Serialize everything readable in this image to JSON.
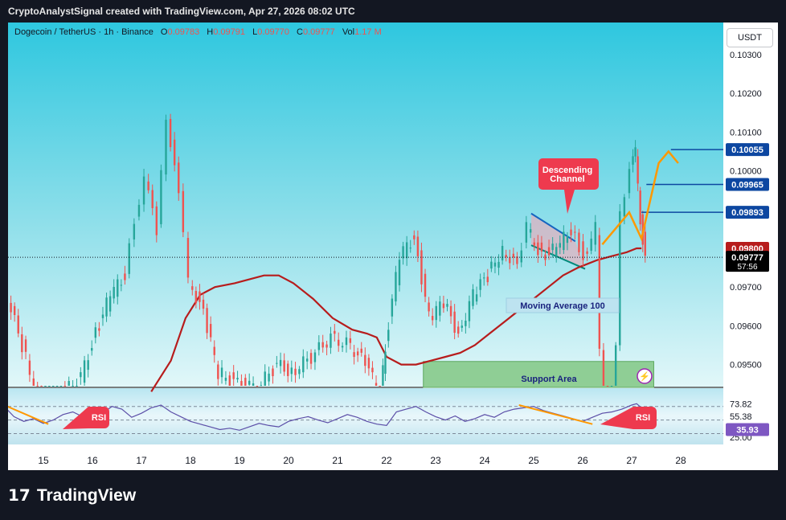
{
  "header": {
    "credit": "CryptoAnalystSignal created with TradingView.com, Apr 27, 2026 08:02 UTC",
    "symbol": "Dogecoin / TetherUS · 1h · Binance",
    "ohlc": {
      "O": "0.09783",
      "H": "0.09791",
      "L": "0.09770",
      "C": "0.09777",
      "Vol": "1.17 M"
    },
    "o_label": "O",
    "h_label": "H",
    "l_label": "L",
    "c_label": "C",
    "vol_label": "Vol",
    "currency_button": "USDT"
  },
  "footer": {
    "brand": "TradingView"
  },
  "colors": {
    "up": "#26a69a",
    "down": "#ef5350",
    "ma": "#b71c1c",
    "level": "#0d47a1",
    "arrow": "#ff9800",
    "support": "#81c784"
  },
  "chart_data": [
    {
      "type": "line",
      "title": "Dogecoin / TetherUS · 1h · Binance",
      "ylim": [
        0.0945,
        0.1035
      ],
      "x_ticks": [
        "15",
        "16",
        "17",
        "18",
        "19",
        "20",
        "21",
        "22",
        "23",
        "24",
        "25",
        "26",
        "27",
        "28"
      ],
      "y_ticks": [
        "0.10300",
        "0.10200",
        "0.10100",
        "0.10000",
        "0.09700",
        "0.09600",
        "0.09500"
      ],
      "price_labels": [
        {
          "value": 0.10055,
          "text": "0.10055"
        },
        {
          "value": 0.09965,
          "text": "0.09965"
        },
        {
          "value": 0.09893,
          "text": "0.09893"
        },
        {
          "value": 0.098,
          "text": "0.09800"
        },
        {
          "value": 0.09777,
          "text": "0.09777",
          "countdown": "57:56"
        }
      ],
      "price_path": {
        "days": [
          14.0,
          14.3,
          14.6,
          15.0,
          15.4,
          15.8,
          16.1,
          16.4,
          16.7,
          16.9,
          17.1,
          17.35,
          17.55,
          17.8,
          18.0,
          18.3,
          18.6,
          19.0,
          19.4,
          19.8,
          20.1,
          20.5,
          20.9,
          21.3,
          21.6,
          21.9,
          22.0,
          22.3,
          22.6,
          22.9,
          23.2,
          23.5,
          23.8,
          24.1,
          24.4,
          24.7,
          24.9,
          25.2,
          25.5,
          25.8,
          26.05,
          26.3,
          26.55,
          26.8,
          27.0,
          27.1,
          27.2,
          27.3
        ],
        "prices": [
          0.0952,
          0.0967,
          0.0955,
          0.0938,
          0.0942,
          0.0947,
          0.0958,
          0.0968,
          0.0973,
          0.0988,
          0.0998,
          0.0985,
          0.1015,
          0.0993,
          0.0972,
          0.0963,
          0.0948,
          0.0945,
          0.0944,
          0.095,
          0.0948,
          0.0952,
          0.0957,
          0.0955,
          0.095,
          0.0943,
          0.0955,
          0.0978,
          0.0983,
          0.0962,
          0.0966,
          0.0958,
          0.0968,
          0.0973,
          0.098,
          0.0975,
          0.0985,
          0.0978,
          0.098,
          0.0985,
          0.0978,
          0.0985,
          0.089,
          0.099,
          0.1,
          0.1005,
          0.0988,
          0.0977
        ]
      },
      "moving_average": {
        "label": "Moving Average 100",
        "days": [
          17.2,
          17.6,
          17.9,
          18.2,
          18.5,
          18.9,
          19.2,
          19.5,
          19.8,
          20.1,
          20.5,
          20.9,
          21.3,
          21.6,
          21.8,
          22.0,
          22.3,
          22.6,
          22.9,
          23.2,
          23.5,
          23.8,
          24.1,
          24.4,
          24.7,
          25.0,
          25.3,
          25.6,
          25.9,
          26.1,
          26.3,
          26.6,
          26.9,
          27.1,
          27.2
        ],
        "values": [
          0.0943,
          0.0951,
          0.0962,
          0.0968,
          0.097,
          0.0971,
          0.0972,
          0.0973,
          0.0973,
          0.0971,
          0.0967,
          0.0962,
          0.0959,
          0.0958,
          0.0957,
          0.0952,
          0.095,
          0.095,
          0.0951,
          0.0952,
          0.0953,
          0.0955,
          0.0958,
          0.0961,
          0.0964,
          0.0967,
          0.097,
          0.0973,
          0.0975,
          0.0976,
          0.0977,
          0.0978,
          0.0979,
          0.098,
          0.098
        ]
      },
      "levels": [
        {
          "value": 0.10055,
          "from_day": 27.8
        },
        {
          "value": 0.09965,
          "from_day": 27.3
        },
        {
          "value": 0.09893,
          "from_day": 27.2
        }
      ],
      "annotations": [
        {
          "kind": "descending_channel",
          "label": "Descending Channel",
          "upper": [
            [
              24.95,
              0.0989
            ],
            [
              25.85,
              0.09818
            ]
          ],
          "lower": [
            [
              24.95,
              0.09808
            ],
            [
              26.05,
              0.09747
            ]
          ]
        },
        {
          "kind": "support_area",
          "label": "Support Area",
          "from_day": 22.75,
          "to_day": 27.45,
          "top": 0.09508,
          "bottom": 0.0946
        },
        {
          "kind": "projection_arrow",
          "points": [
            [
              26.4,
              0.0981
            ],
            [
              26.95,
              0.09893
            ],
            [
              27.2,
              0.09825
            ],
            [
              27.55,
              0.1002
            ],
            [
              27.75,
              0.1005
            ],
            [
              27.95,
              0.1002
            ]
          ]
        }
      ]
    },
    {
      "type": "line",
      "title": "RSI",
      "ylim": [
        20,
        85
      ],
      "y_ticks": [
        "73.82",
        "55.38",
        "35.93",
        "25.00"
      ],
      "levels": [
        70,
        50,
        30
      ],
      "last_value": 35.93,
      "series": [
        {
          "days": [
            14.0,
            14.2,
            14.4,
            14.6,
            14.8,
            15.0,
            15.2,
            15.4,
            15.6,
            15.8,
            16.0,
            16.2,
            16.4,
            16.6,
            16.8,
            17.0,
            17.2,
            17.4,
            17.6,
            17.8,
            18.0,
            18.2,
            18.4,
            18.6,
            18.8,
            19.0,
            19.2,
            19.4,
            19.6,
            19.8,
            20.0,
            20.2,
            20.4,
            20.6,
            20.8,
            21.0,
            21.2,
            21.4,
            21.6,
            21.8,
            22.0,
            22.2,
            22.4,
            22.6,
            22.8,
            23.0,
            23.2,
            23.4,
            23.6,
            23.8,
            24.0,
            24.2,
            24.4,
            24.6,
            24.8,
            25.0,
            25.2,
            25.4,
            25.6,
            25.8,
            26.0,
            26.2,
            26.4,
            26.6,
            26.8,
            27.0,
            27.1,
            27.2,
            27.3
          ],
          "values": [
            62,
            70,
            55,
            48,
            52,
            45,
            50,
            58,
            62,
            55,
            48,
            60,
            70,
            66,
            54,
            60,
            68,
            72,
            62,
            55,
            48,
            44,
            40,
            36,
            38,
            35,
            40,
            45,
            42,
            40,
            48,
            52,
            55,
            50,
            46,
            52,
            58,
            54,
            48,
            44,
            42,
            62,
            66,
            70,
            62,
            55,
            50,
            56,
            48,
            52,
            58,
            54,
            62,
            66,
            68,
            70,
            64,
            60,
            56,
            52,
            48,
            54,
            60,
            62,
            66,
            72,
            74,
            68,
            40
          ]
        }
      ]
    }
  ],
  "rsi_divergence_lines": [
    {
      "from": [
        14.2,
        72
      ],
      "to": [
        15.1,
        44
      ]
    },
    {
      "from": [
        24.7,
        72
      ],
      "to": [
        26.2,
        44
      ]
    }
  ],
  "tags": {
    "descending_channel_line1": "Descending",
    "descending_channel_line2": "Channel",
    "rsi_left": "RSI",
    "rsi_right": "RSI",
    "moving_average": "Moving Average 100",
    "support_area": "Support Area"
  }
}
